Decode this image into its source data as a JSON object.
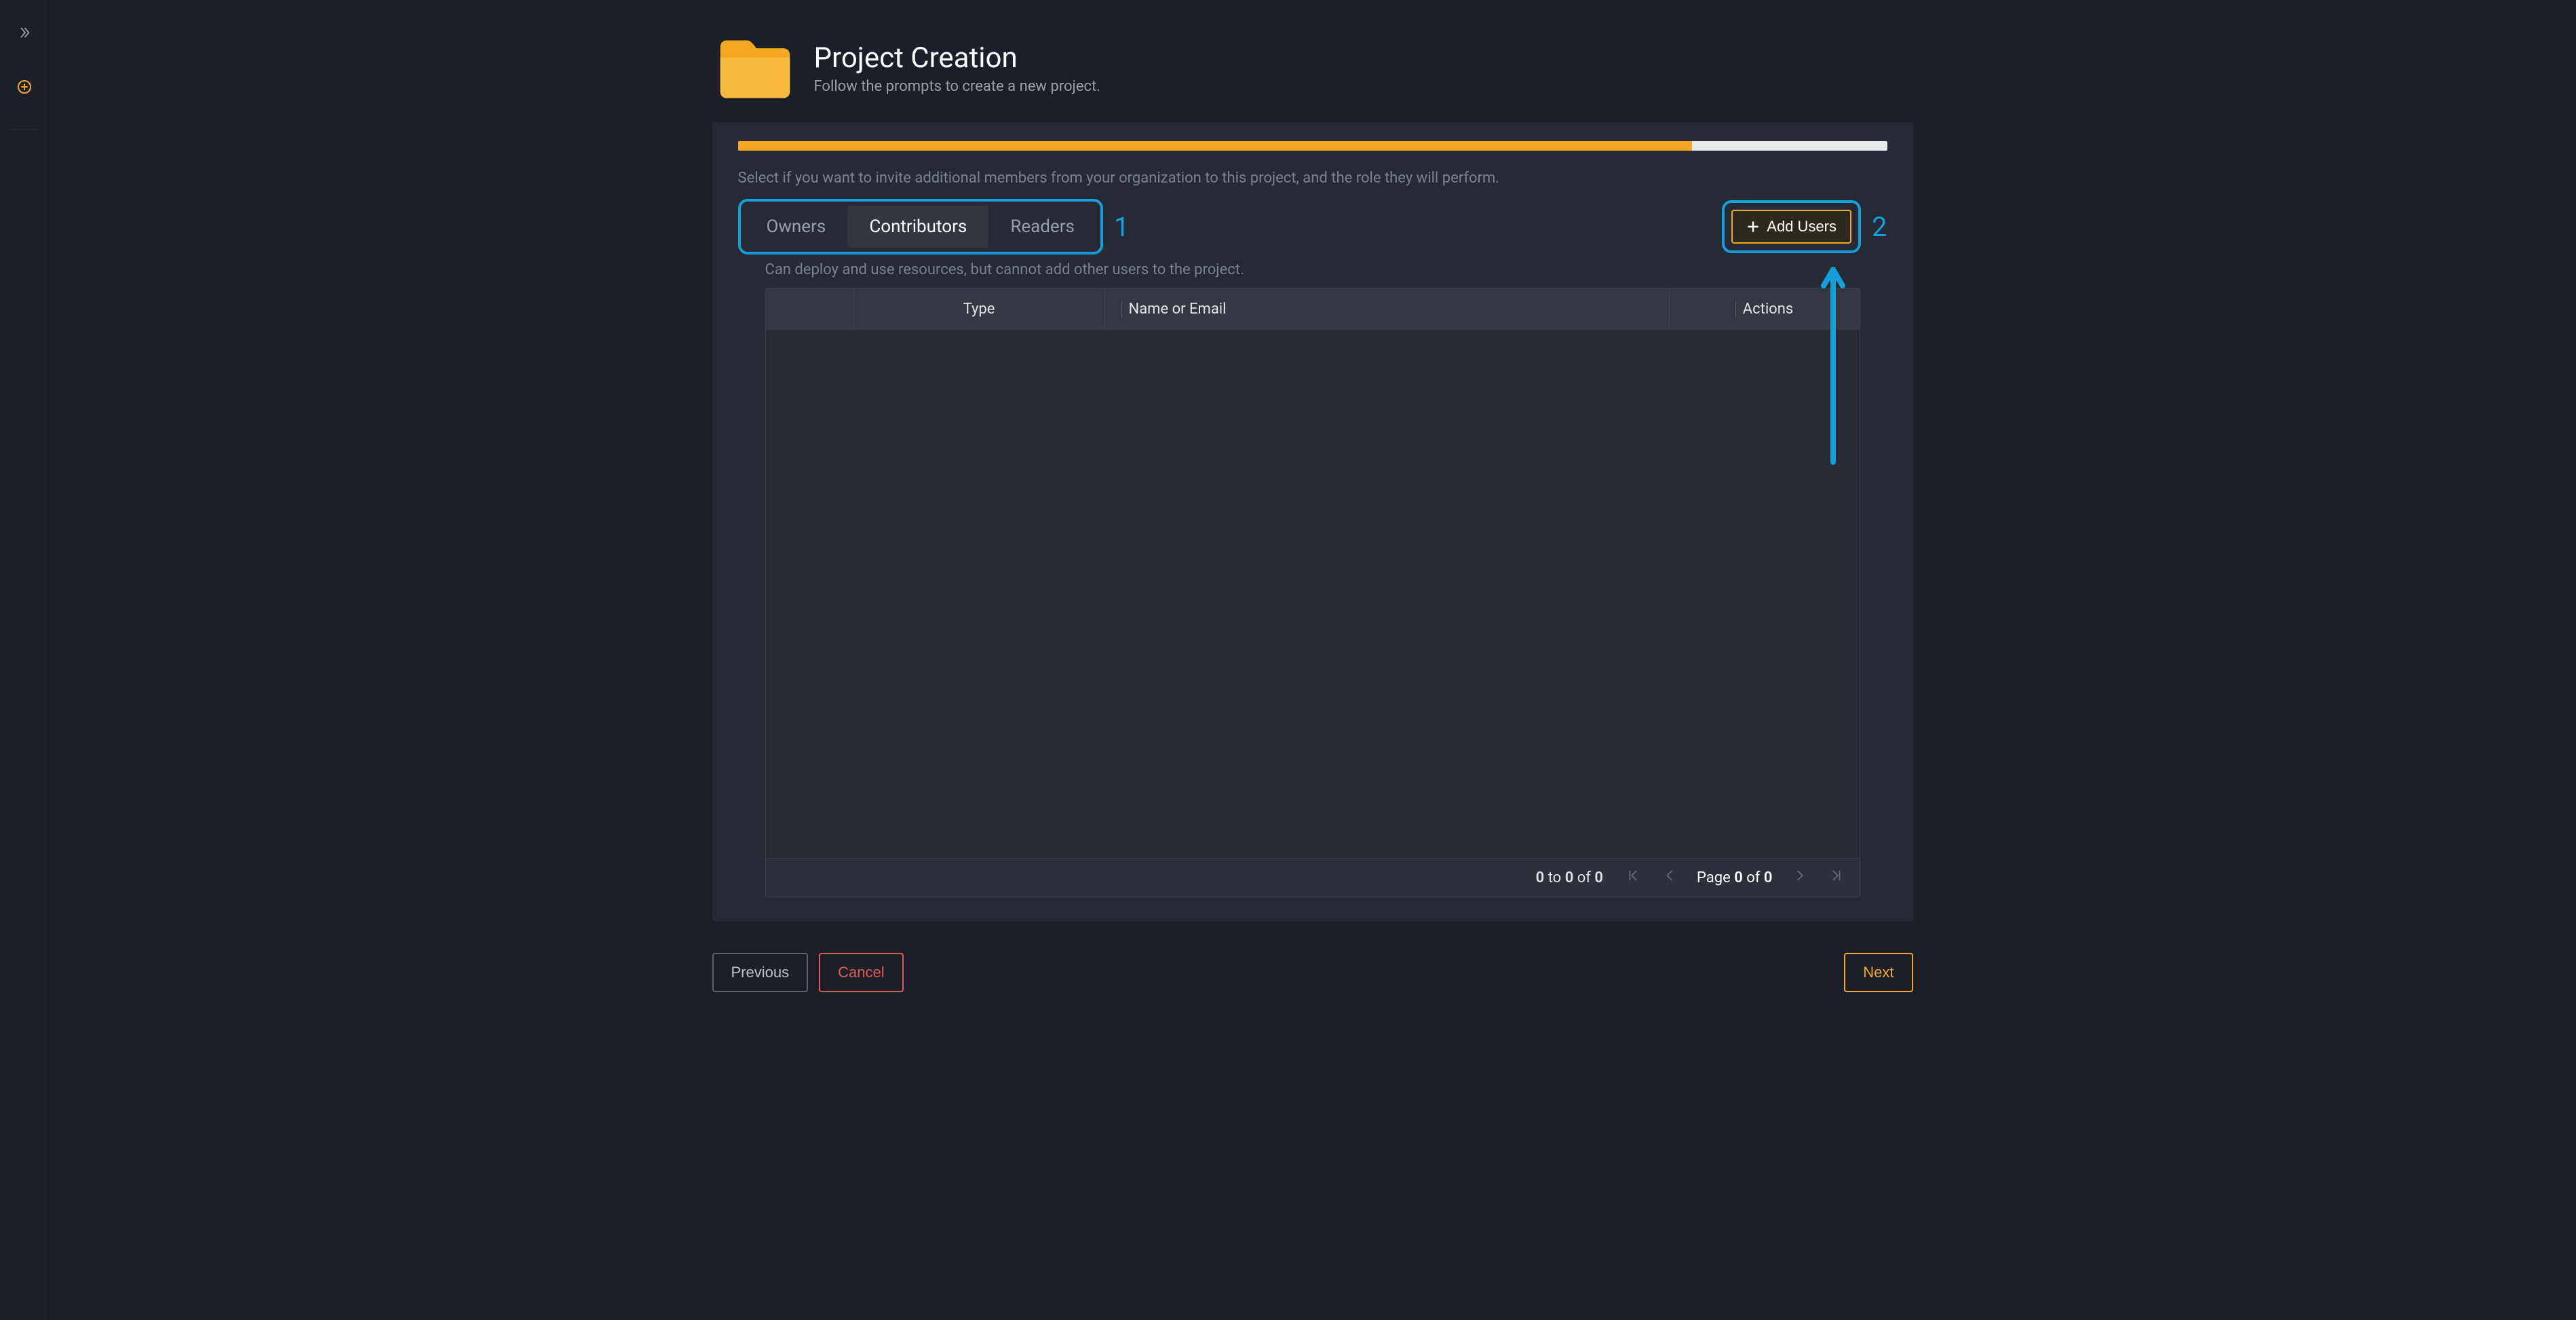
{
  "sidebar": {
    "expand_label": "Expand sidebar",
    "add_label": "New"
  },
  "header": {
    "title": "Project Creation",
    "subtitle": "Follow the prompts to create a new project."
  },
  "progress": {
    "percent": 83
  },
  "step": {
    "instructions": "Select if you want to invite additional members from your organization to this project, and the role they will perform.",
    "tabs": [
      {
        "id": "owners",
        "label": "Owners",
        "active": false
      },
      {
        "id": "contributors",
        "label": "Contributors",
        "active": true
      },
      {
        "id": "readers",
        "label": "Readers",
        "active": false
      }
    ],
    "role_description": "Can deploy and use resources, but cannot add other users to the project.",
    "add_users_button": "Add Users"
  },
  "annotations": {
    "tabs_number": "1",
    "add_users_number": "2"
  },
  "table": {
    "columns": {
      "type": "Type",
      "name_or_email": "Name or Email",
      "actions": "Actions"
    },
    "rows": []
  },
  "pagination": {
    "counts": {
      "from": "0",
      "to_word": "to",
      "to": "0",
      "of_word": "of",
      "total": "0"
    },
    "page_label": "Page",
    "page_current": "0",
    "page_of_word": "of",
    "page_total": "0"
  },
  "wizard": {
    "previous": "Previous",
    "cancel": "Cancel",
    "next": "Next"
  },
  "colors": {
    "accent": "#F5A623",
    "annotation": "#149FDB",
    "danger": "#E05A5A"
  }
}
